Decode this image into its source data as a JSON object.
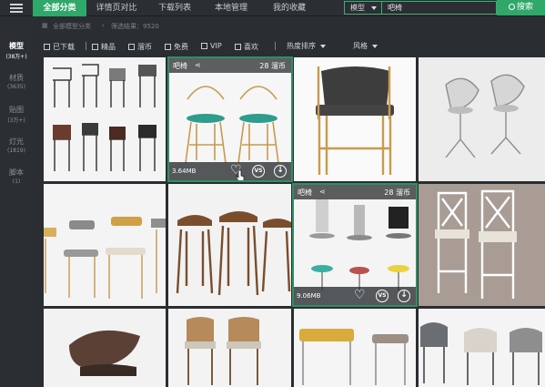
{
  "topbar": {
    "tabs": [
      {
        "label": "全部分类",
        "active": true
      },
      {
        "label": "详情页对比",
        "active": false
      },
      {
        "label": "下载列表",
        "active": false
      },
      {
        "label": "本地管理",
        "active": false
      },
      {
        "label": "我的收藏",
        "active": false
      }
    ],
    "search_type": "模型",
    "search_value": "吧椅",
    "search_button": "搜索"
  },
  "sidebar": {
    "items": [
      {
        "label": "模型",
        "count": "(38万+)",
        "active": true
      },
      {
        "label": "材质",
        "count": "(3635)",
        "active": false
      },
      {
        "label": "贴图",
        "count": "(3万+)",
        "active": false
      },
      {
        "label": "灯光",
        "count": "(1819)",
        "active": false
      },
      {
        "label": "脚本",
        "count": "(1)",
        "active": false
      }
    ]
  },
  "breadcrumb": {
    "path": "全部模型分类",
    "result_label": "筛选结果：9520"
  },
  "filters": {
    "checkboxes": [
      {
        "label": "已下载"
      },
      {
        "label": "精品"
      },
      {
        "label": "溜币"
      },
      {
        "label": "免费"
      },
      {
        "label": "VIP"
      },
      {
        "label": "喜欢"
      }
    ],
    "sort_label": "热度排序",
    "style_label": "风格"
  },
  "cards": {
    "card2": {
      "name": "吧椅",
      "price": "28 溜币",
      "size": "3.64MB",
      "vs": "VS"
    },
    "card8": {
      "name": "吧椅",
      "price": "28 溜币",
      "size": "9.06MB",
      "vs": "VS"
    }
  },
  "colors": {
    "accent": "#2fa86a",
    "dark_bg": "#2a2d31",
    "highlight": "#2f8f62"
  }
}
